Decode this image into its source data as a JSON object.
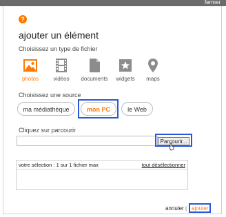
{
  "window": {
    "close_label": "fermer"
  },
  "dialog": {
    "help_glyph": "?",
    "title": "ajouter un élément",
    "file_type_prompt": "Choisissez un type de fichier",
    "file_types": [
      {
        "label": "photos",
        "icon": "photo-icon",
        "active": true
      },
      {
        "label": "vidéos",
        "icon": "film-icon",
        "active": false
      },
      {
        "label": "documents",
        "icon": "document-icon",
        "active": false
      },
      {
        "label": "widgets",
        "icon": "widget-icon",
        "active": false
      },
      {
        "label": "maps",
        "icon": "map-pin-icon",
        "active": false
      }
    ],
    "source_prompt": "Choisissez une source",
    "sources": [
      {
        "label": "ma médiathèque",
        "active": false
      },
      {
        "label": "mon PC",
        "active": true
      },
      {
        "label": "le Web",
        "active": false
      }
    ],
    "browse_prompt": "Cliquez sur parcourir",
    "path_value": "",
    "browse_label": "Parcourir...",
    "selection_text": "votre sélection : 1 sur 1 fichier max",
    "deselect_all_label": "tout désélectionner",
    "cancel_label": "annuler",
    "separator": "|",
    "add_label": "ajouter"
  },
  "colors": {
    "accent": "#ff7900",
    "highlight": "#2a57d8",
    "icon_gray": "#8c8c8c"
  }
}
